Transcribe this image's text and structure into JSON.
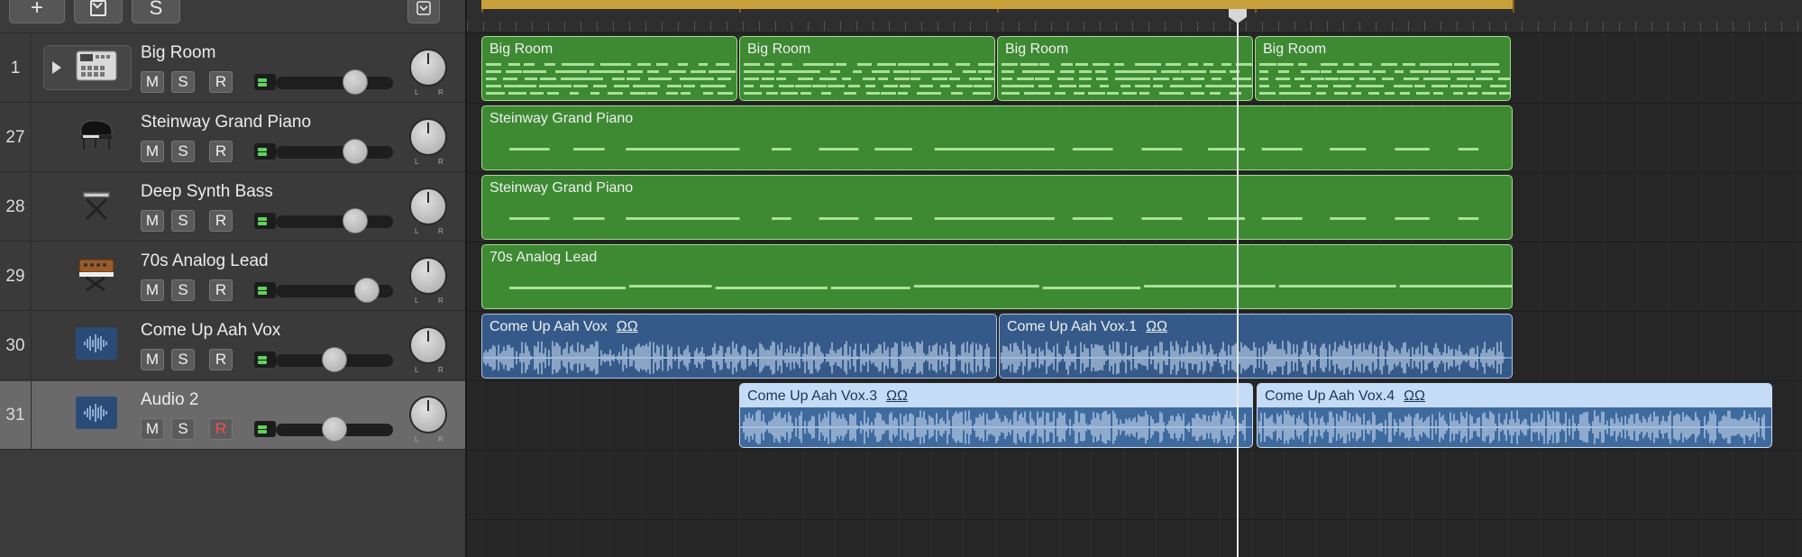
{
  "toolbar": {
    "add_label": "+",
    "duplicate_icon": "duplicate-track-icon",
    "solo_label": "S",
    "collapse_icon": "chevron-down-icon"
  },
  "tracks": [
    {
      "number": "1",
      "name": "Big Room",
      "icon": "drum-machine-icon",
      "mute": "M",
      "solo": "S",
      "rec": "R",
      "volume_level": 0.68,
      "armed": false,
      "selected": false
    },
    {
      "number": "27",
      "name": "Steinway Grand Piano",
      "icon": "grand-piano-icon",
      "mute": "M",
      "solo": "S",
      "rec": "R",
      "volume_level": 0.68,
      "armed": false,
      "selected": false
    },
    {
      "number": "28",
      "name": "Deep Synth Bass",
      "icon": "keyboard-stand-icon",
      "mute": "M",
      "solo": "S",
      "rec": "R",
      "volume_level": 0.68,
      "armed": false,
      "selected": false
    },
    {
      "number": "29",
      "name": "70s Analog Lead",
      "icon": "synth-icon",
      "mute": "M",
      "solo": "S",
      "rec": "R",
      "volume_level": 0.78,
      "armed": false,
      "selected": false
    },
    {
      "number": "30",
      "name": "Come Up Aah Vox",
      "icon": "waveform-icon",
      "mute": "M",
      "solo": "S",
      "rec": "R",
      "volume_level": 0.5,
      "armed": false,
      "selected": false
    },
    {
      "number": "31",
      "name": "Audio 2",
      "icon": "waveform-icon",
      "mute": "M",
      "solo": "S",
      "rec": "R",
      "volume_level": 0.5,
      "armed": true,
      "selected": true
    }
  ],
  "pan": {
    "left": "L",
    "right": "R"
  },
  "regions": {
    "big_room": [
      "Big Room",
      "Big Room",
      "Big Room",
      "Big Room"
    ],
    "steinway": "Steinway Grand Piano",
    "deep_synth": "Steinway Grand Piano",
    "analog_lead": "70s Analog Lead",
    "vox_a": "Come Up Aah Vox",
    "vox_b": "Come Up Aah Vox.1",
    "vox_c": "Come Up Aah Vox.3",
    "vox_d": "Come Up Aah Vox.4",
    "loop_symbol": "ΩΩ"
  },
  "colors": {
    "midi_region": "#3d8a33",
    "audio_region": "#355a8a",
    "cycle": "#c9a13b",
    "record_armed": "#ff4a4a"
  }
}
